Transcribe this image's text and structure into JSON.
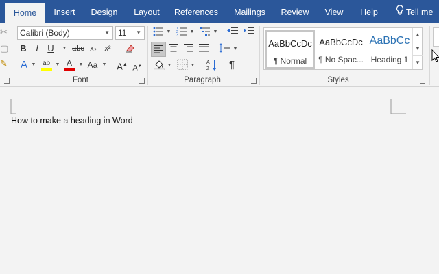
{
  "tabs": [
    {
      "label": "Home",
      "active": true
    },
    {
      "label": "Insert"
    },
    {
      "label": "Design"
    },
    {
      "label": "Layout"
    },
    {
      "label": "References"
    },
    {
      "label": "Mailings"
    },
    {
      "label": "Review"
    },
    {
      "label": "View"
    },
    {
      "label": "Help"
    },
    {
      "label": "Tell me"
    }
  ],
  "font": {
    "family": "Calibri (Body)",
    "size": "11",
    "group_label": "Font",
    "bold": "B",
    "italic": "I",
    "underline": "U",
    "strike": "abc",
    "subscript": "x₂",
    "superscript": "x²",
    "change_case": "Aa",
    "grow": "A",
    "shrink": "A",
    "effects": "A",
    "font_color": "A",
    "highlight_color": "#ffff00",
    "font_color_value": "#e00000"
  },
  "paragraph": {
    "group_label": "Paragraph"
  },
  "styles": {
    "group_label": "Styles",
    "items": [
      {
        "sample": "AaBbCcDc",
        "name": "¶ Normal",
        "selected": true
      },
      {
        "sample": "AaBbCcDc",
        "name": "¶ No Spac..."
      },
      {
        "sample": "AaBbCc",
        "name": "Heading 1",
        "accent": "#2e74b5"
      }
    ]
  },
  "document": {
    "text": "How to make a heading in Word"
  },
  "colors": {
    "ribbon_tab_bg": "#2b579a"
  }
}
